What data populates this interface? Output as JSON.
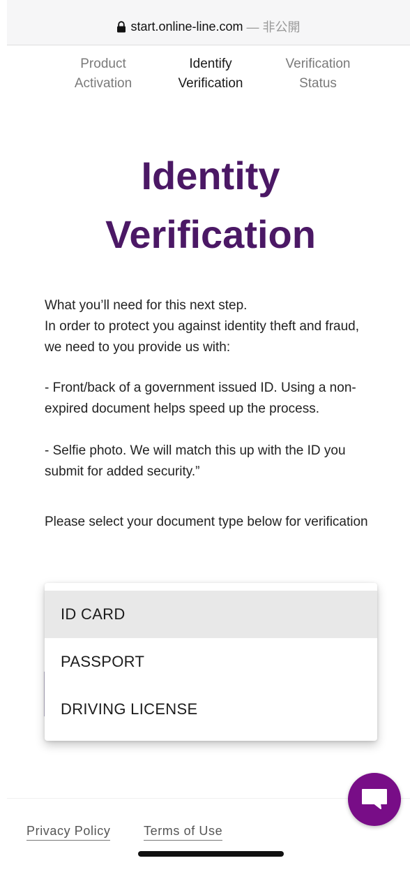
{
  "browser": {
    "host": "start.online-line.com",
    "separator": "—",
    "privacy_status": "非公開"
  },
  "steps": [
    {
      "line1": "Product",
      "line2": "Activation",
      "active": false
    },
    {
      "line1": "Identify",
      "line2": "Verification",
      "active": true
    },
    {
      "line1": "Verification",
      "line2": "Status",
      "active": false
    }
  ],
  "title": {
    "line1": "Identity",
    "line2": "Verification"
  },
  "intro": {
    "line1": "What you’ll need for this next step.",
    "line2": "In order to protect you against identity theft and fraud, we need to you provide us with:"
  },
  "requirements": {
    "id": "- Front/back of a government issued ID. Using a non-expired document helps speed up the process.",
    "selfie": "- Selfie photo. We will match this up with the ID you submit for added security.”"
  },
  "select_prompt": "Please select your document type below for verification",
  "document_options": [
    "ID CARD",
    "PASSPORT",
    "DRIVING LICENSE"
  ],
  "selected_index": 0,
  "footer": {
    "privacy": "Privacy Policy",
    "terms": "Terms of Use"
  },
  "colors": {
    "brand_purple": "#4b1865",
    "chat_purple": "#780d87",
    "highlight": "#e8e8e8"
  },
  "icons": {
    "lock": "lock-icon",
    "chat": "chat-icon"
  }
}
